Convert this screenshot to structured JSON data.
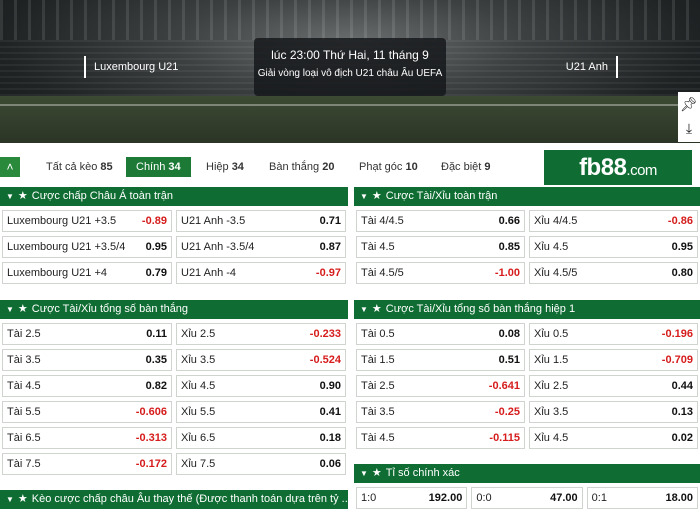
{
  "match": {
    "home": "Luxembourg U21",
    "away": "U21 Anh",
    "time": "lúc 23:00 Thứ Hai, 11 tháng 9",
    "league": "Giải vòng loại vô địch U21 châu Âu UEFA"
  },
  "tools": {
    "pin_icon": "pin-icon",
    "download_icon": "download-icon"
  },
  "tabs": [
    {
      "label": "Tất cả kèo",
      "count": "85"
    },
    {
      "label": "Chính",
      "count": "34"
    },
    {
      "label": "Hiệp",
      "count": "34"
    },
    {
      "label": "Bàn thắng",
      "count": "20"
    },
    {
      "label": "Phạt góc",
      "count": "10"
    },
    {
      "label": "Đặc biệt",
      "count": "9"
    }
  ],
  "brand": {
    "name": "fb88",
    "suffix": ".com"
  },
  "panels": {
    "handicap": {
      "title": "Cược chấp Châu Á toàn trận",
      "rows": [
        [
          {
            "label": "Luxembourg U21 +3.5",
            "odd": "-0.89"
          },
          {
            "label": "U21 Anh -3.5",
            "odd": "0.71"
          }
        ],
        [
          {
            "label": "Luxembourg U21 +3.5/4",
            "odd": "0.95"
          },
          {
            "label": "U21 Anh -3.5/4",
            "odd": "0.87"
          }
        ],
        [
          {
            "label": "Luxembourg U21 +4",
            "odd": "0.79"
          },
          {
            "label": "U21 Anh -4",
            "odd": "-0.97"
          }
        ]
      ]
    },
    "overunder": {
      "title": "Cược Tài/Xỉu toàn trận",
      "rows": [
        [
          {
            "label": "Tài 4/4.5",
            "odd": "0.66"
          },
          {
            "label": "Xỉu 4/4.5",
            "odd": "-0.86"
          }
        ],
        [
          {
            "label": "Tài 4.5",
            "odd": "0.85"
          },
          {
            "label": "Xỉu 4.5",
            "odd": "0.95"
          }
        ],
        [
          {
            "label": "Tài 4.5/5",
            "odd": "-1.00"
          },
          {
            "label": "Xỉu 4.5/5",
            "odd": "0.80"
          }
        ]
      ]
    },
    "totalgoals": {
      "title": "Cược Tài/Xỉu tổng số bàn thắng",
      "rows": [
        [
          {
            "label": "Tài 2.5",
            "odd": "0.11"
          },
          {
            "label": "Xỉu 2.5",
            "odd": "-0.233"
          }
        ],
        [
          {
            "label": "Tài 3.5",
            "odd": "0.35"
          },
          {
            "label": "Xỉu 3.5",
            "odd": "-0.524"
          }
        ],
        [
          {
            "label": "Tài 4.5",
            "odd": "0.82"
          },
          {
            "label": "Xỉu 4.5",
            "odd": "0.90"
          }
        ],
        [
          {
            "label": "Tài 5.5",
            "odd": "-0.606"
          },
          {
            "label": "Xỉu 5.5",
            "odd": "0.41"
          }
        ],
        [
          {
            "label": "Tài 6.5",
            "odd": "-0.313"
          },
          {
            "label": "Xỉu 6.5",
            "odd": "0.18"
          }
        ],
        [
          {
            "label": "Tài 7.5",
            "odd": "-0.172"
          },
          {
            "label": "Xỉu 7.5",
            "odd": "0.06"
          }
        ]
      ]
    },
    "firsthalf": {
      "title": "Cược Tài/Xỉu tổng số bàn thắng hiệp 1",
      "rows": [
        [
          {
            "label": "Tài 0.5",
            "odd": "0.08"
          },
          {
            "label": "Xỉu 0.5",
            "odd": "-0.196"
          }
        ],
        [
          {
            "label": "Tài 1.5",
            "odd": "0.51"
          },
          {
            "label": "Xỉu 1.5",
            "odd": "-0.709"
          }
        ],
        [
          {
            "label": "Tài 2.5",
            "odd": "-0.641"
          },
          {
            "label": "Xỉu 2.5",
            "odd": "0.44"
          }
        ],
        [
          {
            "label": "Tài 3.5",
            "odd": "-0.25"
          },
          {
            "label": "Xỉu 3.5",
            "odd": "0.13"
          }
        ],
        [
          {
            "label": "Tài 4.5",
            "odd": "-0.115"
          },
          {
            "label": "Xỉu 4.5",
            "odd": "0.02"
          }
        ]
      ]
    },
    "exactscore": {
      "title": "Tỉ số chính xác",
      "rows": [
        [
          {
            "label": "1:0",
            "odd": "192.00"
          },
          {
            "label": "0:0",
            "odd": "47.00"
          },
          {
            "label": "0:1",
            "odd": "18.00"
          }
        ]
      ]
    },
    "european": {
      "title": "Kèo cược chấp châu Âu thay thế (Được thanh toán dựa trên tỷ ..."
    }
  },
  "colors": {
    "header_green": "#0f6d33",
    "active_tab": "#1c7a36",
    "negative": "#d61c1c"
  }
}
